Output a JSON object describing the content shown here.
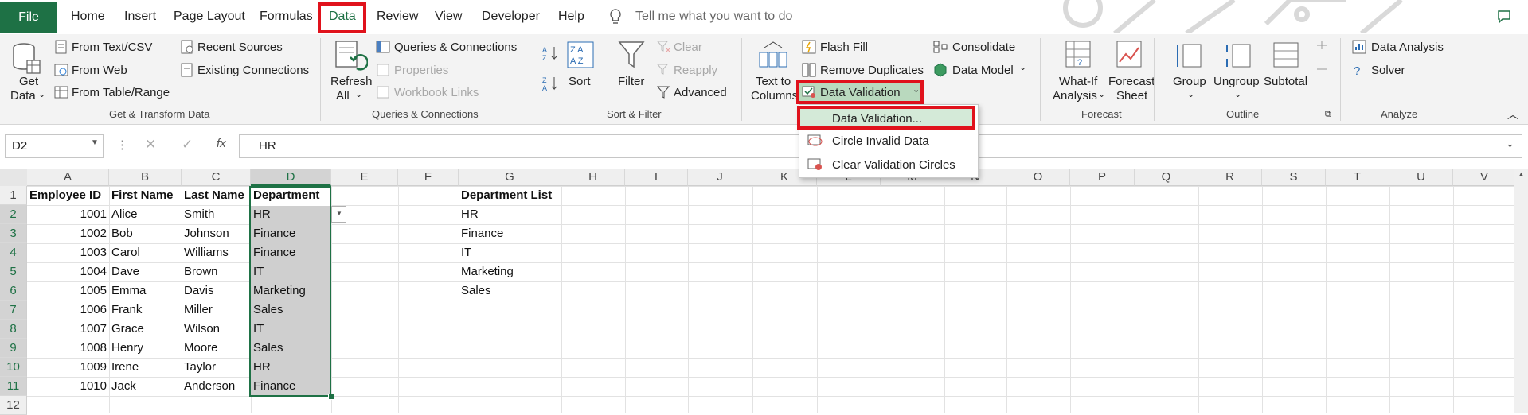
{
  "menu": {
    "file": "File",
    "tabs": [
      "Home",
      "Insert",
      "Page Layout",
      "Formulas",
      "Data",
      "Review",
      "View",
      "Developer",
      "Help"
    ],
    "active_tab": "Data",
    "tell_me": "Tell me what you want to do"
  },
  "ribbon": {
    "get_transform": {
      "get_data": [
        "Get",
        "Data"
      ],
      "from_text_csv": "From Text/CSV",
      "from_web": "From Web",
      "from_table": "From Table/Range",
      "recent_sources": "Recent Sources",
      "existing_connections": "Existing Connections",
      "label": "Get & Transform Data"
    },
    "queries": {
      "refresh_all": [
        "Refresh",
        "All"
      ],
      "queries_connections": "Queries & Connections",
      "properties": "Properties",
      "workbook_links": "Workbook Links",
      "label": "Queries & Connections"
    },
    "sort_filter": {
      "sort": "Sort",
      "filter": "Filter",
      "clear": "Clear",
      "reapply": "Reapply",
      "advanced": "Advanced",
      "label": "Sort & Filter"
    },
    "data_tools": {
      "text_to_columns": [
        "Text to",
        "Columns"
      ],
      "flash_fill": "Flash Fill",
      "remove_duplicates": "Remove Duplicates",
      "data_validation": "Data Validation",
      "consolidate": "Consolidate",
      "data_model": "Data Model"
    },
    "forecast": {
      "what_if": [
        "What-If",
        "Analysis"
      ],
      "forecast_sheet": [
        "Forecast",
        "Sheet"
      ],
      "label": "Forecast"
    },
    "outline": {
      "group": "Group",
      "ungroup": "Ungroup",
      "subtotal": "Subtotal",
      "label": "Outline"
    },
    "analyze": {
      "data_analysis": "Data Analysis",
      "solver": "Solver",
      "label": "Analyze"
    }
  },
  "dropdown": {
    "items": [
      "Data Validation...",
      "Circle Invalid Data",
      "Clear Validation Circles"
    ]
  },
  "formula_bar": {
    "name_box": "D2",
    "fx": "fx",
    "content": "HR"
  },
  "sheet": {
    "columns": [
      "A",
      "B",
      "C",
      "D",
      "E",
      "F",
      "G",
      "H",
      "I",
      "J",
      "K",
      "L",
      "M",
      "N",
      "O",
      "P",
      "Q",
      "R",
      "S",
      "T",
      "U",
      "V"
    ],
    "rows": [
      "1",
      "2",
      "3",
      "4",
      "5",
      "6",
      "7",
      "8",
      "9",
      "10",
      "11",
      "12"
    ],
    "headers": [
      "Employee ID",
      "First Name",
      "Last Name",
      "Department"
    ],
    "data": [
      [
        "1001",
        "Alice",
        "Smith",
        "HR"
      ],
      [
        "1002",
        "Bob",
        "Johnson",
        "Finance"
      ],
      [
        "1003",
        "Carol",
        "Williams",
        "Finance"
      ],
      [
        "1004",
        "Dave",
        "Brown",
        "IT"
      ],
      [
        "1005",
        "Emma",
        "Davis",
        "Marketing"
      ],
      [
        "1006",
        "Frank",
        "Miller",
        "Sales"
      ],
      [
        "1007",
        "Grace",
        "Wilson",
        "IT"
      ],
      [
        "1008",
        "Henry",
        "Moore",
        "Sales"
      ],
      [
        "1009",
        "Irene",
        "Taylor",
        "HR"
      ],
      [
        "1010",
        "Jack",
        "Anderson",
        "Finance"
      ]
    ],
    "dept_list_header": "Department List",
    "dept_list": [
      "HR",
      "Finance",
      "IT",
      "Marketing",
      "Sales"
    ]
  },
  "colors": {
    "excel_green": "#1e7145",
    "highlight_red": "#e0121c"
  }
}
